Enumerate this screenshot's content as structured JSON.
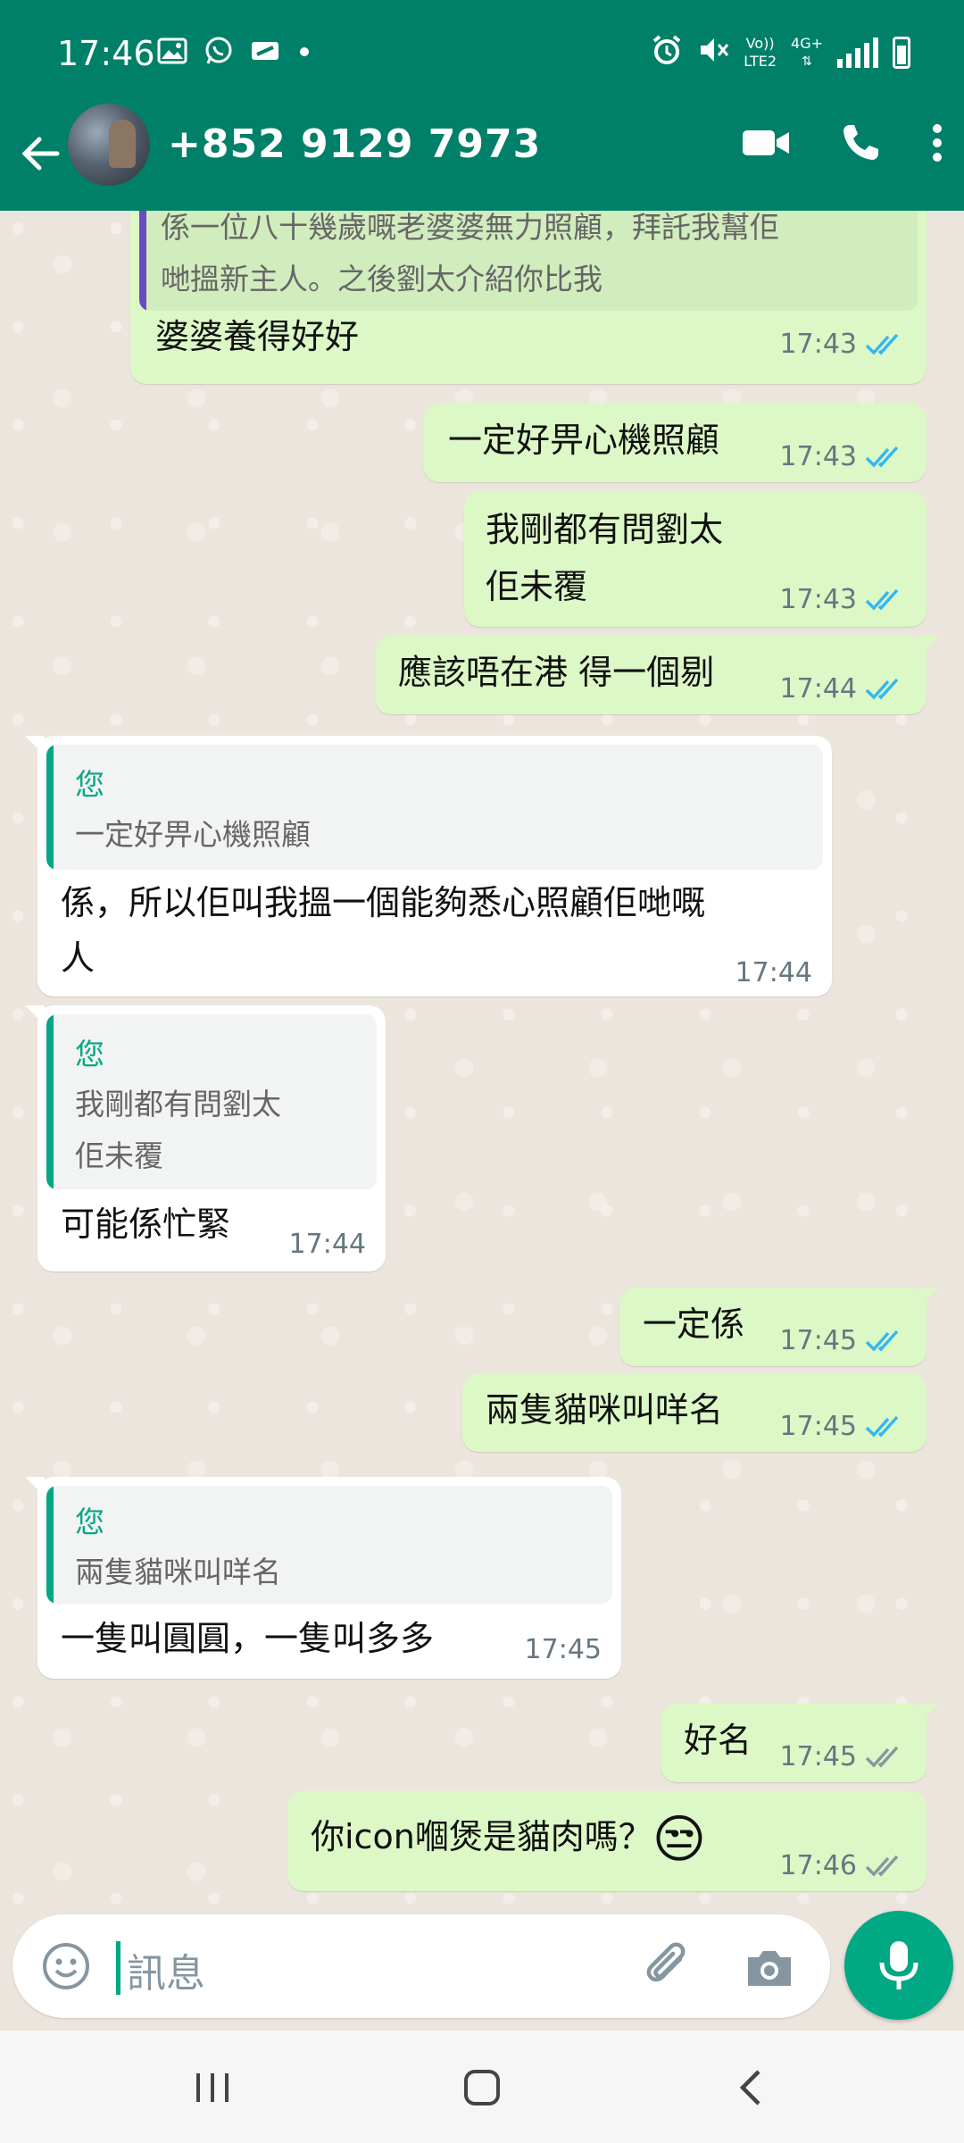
{
  "status_bar": {
    "time": "17:46",
    "network_label_top": "Vo))",
    "network_label_bottom": "LTE2",
    "network_type": "4G+",
    "icons": [
      "gallery-icon",
      "whatsapp-icon",
      "cast-icon",
      "dot-icon",
      "alarm-icon",
      "mute-icon",
      "signal-icon",
      "battery-icon"
    ]
  },
  "header": {
    "contact_name": "+852 9129 7973",
    "icons": [
      "back-arrow-icon",
      "video-call-icon",
      "voice-call-icon",
      "more-vert-icon"
    ]
  },
  "messages": [
    {
      "direction": "out",
      "quote_text_1": "係一位八十幾歲嘅老婆婆無力照顧，拜託我幫佢",
      "quote_text_2": "哋搵新主人。之後劉太介紹你比我",
      "text": "婆婆養得好好",
      "time": "17:43",
      "status": "read"
    },
    {
      "direction": "out",
      "text": "一定好畀心機照顧",
      "time": "17:43",
      "status": "read"
    },
    {
      "direction": "out",
      "text_line1": "我剛都有問劉太",
      "text_line2": "佢未覆",
      "time": "17:43",
      "status": "read"
    },
    {
      "direction": "out",
      "text": "應該唔在港 得一個剔",
      "time": "17:44",
      "status": "read"
    },
    {
      "direction": "in",
      "quote_author": "您",
      "quote_text": "一定好畀心機照顧",
      "text_line1": "係，所以佢叫我搵一個能夠悉心照顧佢哋嘅",
      "text_line2": "人",
      "time": "17:44"
    },
    {
      "direction": "in",
      "quote_author": "您",
      "quote_text_1": "我剛都有問劉太",
      "quote_text_2": "佢未覆",
      "text": "可能係忙緊",
      "time": "17:44"
    },
    {
      "direction": "out",
      "text": "一定係",
      "time": "17:45",
      "status": "read"
    },
    {
      "direction": "out",
      "text": "兩隻貓咪叫咩名",
      "time": "17:45",
      "status": "read"
    },
    {
      "direction": "in",
      "quote_author": "您",
      "quote_text": "兩隻貓咪叫咩名",
      "text": "一隻叫圓圓，一隻叫多多",
      "time": "17:45"
    },
    {
      "direction": "out",
      "text": "好名",
      "time": "17:45",
      "status": "delivered"
    },
    {
      "direction": "out",
      "text": "你icon嗰煲是貓肉嗎？",
      "emoji": "😒",
      "time": "17:46",
      "status": "delivered"
    }
  ],
  "composer": {
    "placeholder": "訊息",
    "icons": [
      "emoji-icon",
      "attach-icon",
      "camera-icon",
      "mic-icon"
    ]
  },
  "nav_bar": {
    "icons": [
      "recents-icon",
      "home-icon",
      "back-icon"
    ]
  },
  "colors": {
    "header": "#008069",
    "outgoing_bubble": "#dcf8c6",
    "incoming_bubble": "#ffffff",
    "accent": "#00a884",
    "read_tick": "#34b7f1",
    "quote_bar_out": "#6a4bc4"
  }
}
